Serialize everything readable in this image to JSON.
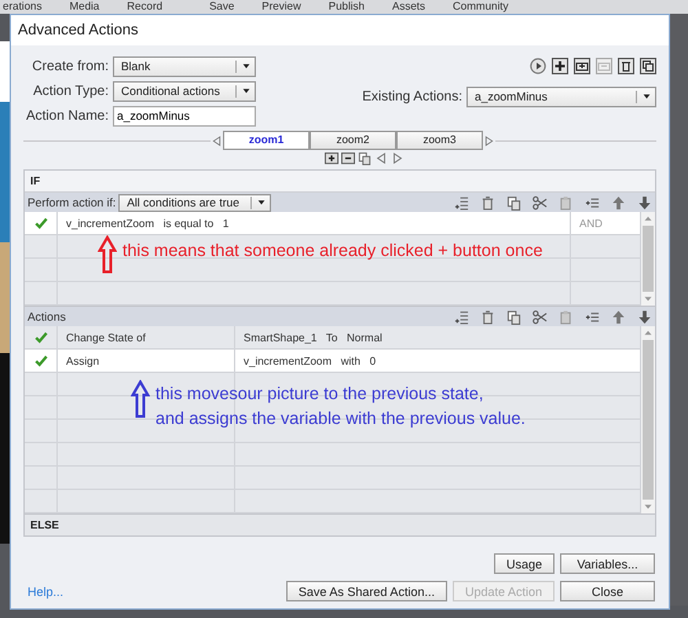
{
  "app_menu": [
    "erations",
    "Media",
    "Record",
    "Save",
    "Preview",
    "Publish",
    "Assets",
    "Community"
  ],
  "window": {
    "title": "Advanced Actions"
  },
  "form": {
    "create_from": {
      "label": "Create from:",
      "value": "Blank"
    },
    "action_type": {
      "label": "Action Type:",
      "value": "Conditional actions"
    },
    "action_name": {
      "label": "Action Name:",
      "value": "a_zoomMinus"
    },
    "existing_actions": {
      "label": "Existing Actions:",
      "value": "a_zoomMinus"
    }
  },
  "tabs": [
    {
      "label": "zoom1",
      "selected": true
    },
    {
      "label": "zoom2",
      "selected": false
    },
    {
      "label": "zoom3",
      "selected": false
    }
  ],
  "if_section": {
    "title": "IF",
    "perform_label": "Perform action if:",
    "perform_value": "All conditions are true",
    "conditions": [
      {
        "checked": true,
        "selected": true,
        "condition": "v_incrementZoom   is equal to   1",
        "connector": "AND"
      }
    ]
  },
  "actions_section": {
    "title": "Actions",
    "actions": [
      {
        "checked": true,
        "selected": false,
        "action": "Change State of",
        "detail": "SmartShape_1   To   Normal"
      },
      {
        "checked": true,
        "selected": true,
        "action": "Assign",
        "detail": "v_incrementZoom   with   0"
      }
    ]
  },
  "else_section": {
    "title": "ELSE"
  },
  "annotations": [
    {
      "kind": "condition",
      "color": "#e8202a",
      "text": "this means that someone already clicked + button once"
    },
    {
      "kind": "actions",
      "color": "#3c3cd2",
      "text": "this movesour picture to the previous state,\nand assigns the variable with the previous value."
    }
  ],
  "buttons": [
    {
      "label": "Usage",
      "disabled": false
    },
    {
      "label": "Variables...",
      "disabled": false
    }
  ],
  "footer": {
    "help": "Help...",
    "buttons": [
      {
        "label": "Save As Shared Action...",
        "disabled": false
      },
      {
        "label": "Update Action",
        "disabled": true
      },
      {
        "label": "Close",
        "disabled": false
      }
    ]
  }
}
